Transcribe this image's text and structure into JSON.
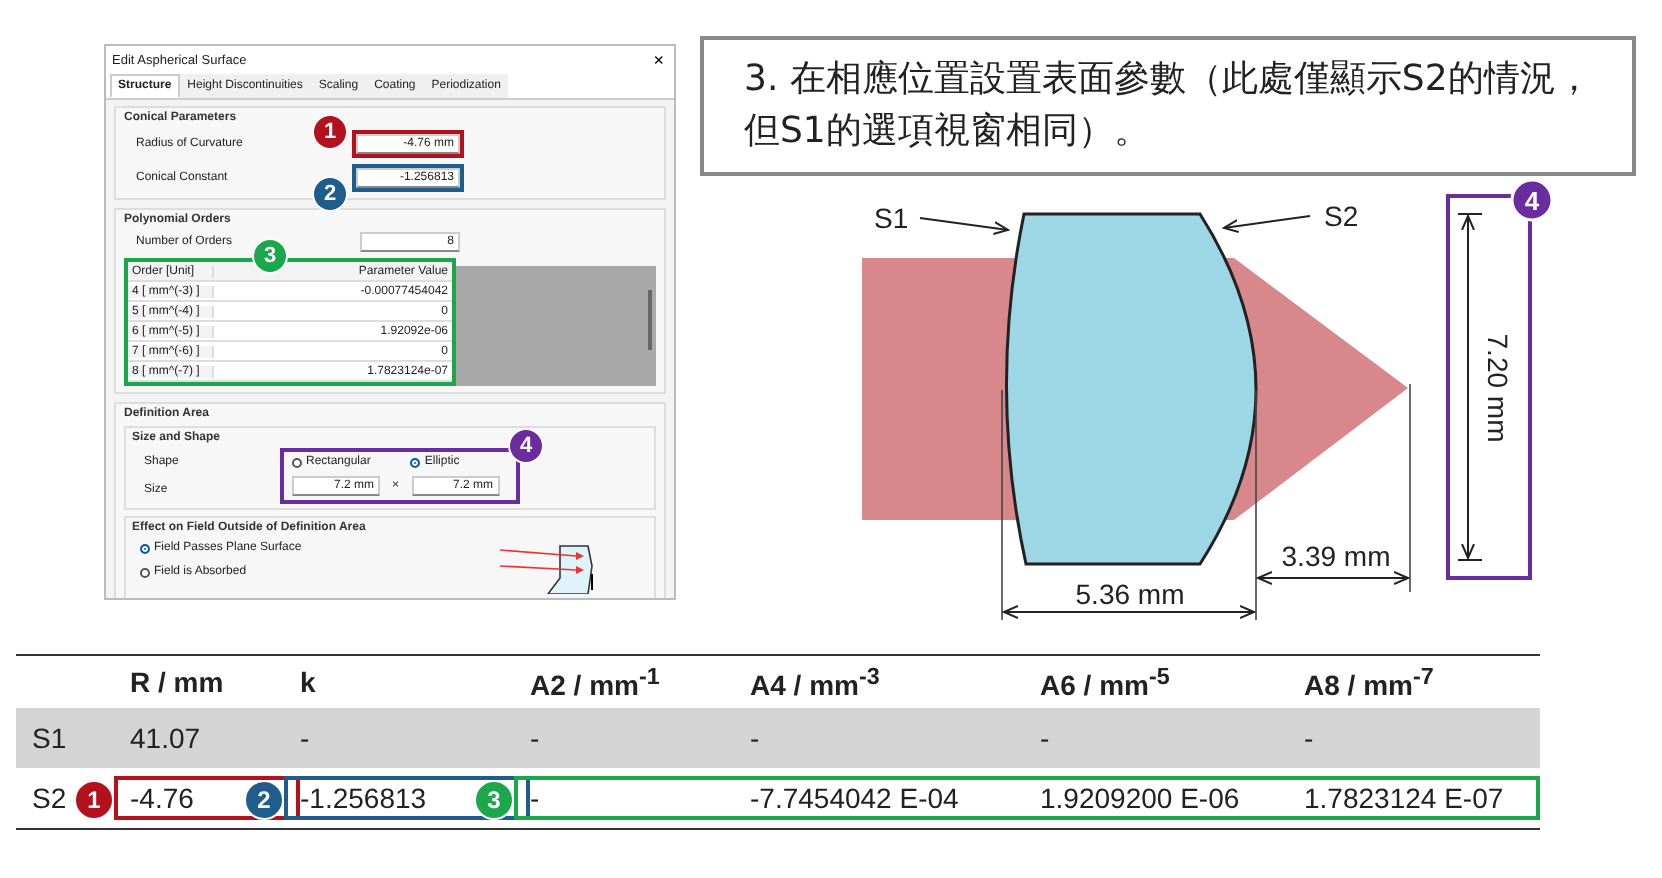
{
  "dialog": {
    "title": "Edit Aspherical Surface",
    "close": "×",
    "tabs": [
      {
        "label": "Structure",
        "selected": true
      },
      {
        "label": "Height Discontinuities",
        "selected": false
      },
      {
        "label": "Scaling",
        "selected": false
      },
      {
        "label": "Coating",
        "selected": false
      },
      {
        "label": "Periodization",
        "selected": false
      }
    ],
    "conical_parameters": {
      "title": "Conical Parameters",
      "fields": [
        {
          "label": "Radius of Curvature",
          "value": "-4.76 mm",
          "callout": "1",
          "color": "#b3121c"
        },
        {
          "label": "Conical Constant",
          "value": "-1.256813",
          "callout": "2",
          "color": "#1f5d8c"
        }
      ]
    },
    "polynomial_orders": {
      "title": "Polynomial Orders",
      "number_label": "Number of Orders",
      "number_value": "8",
      "callout": "3",
      "color": "#1aa84b",
      "columns": [
        "Order [Unit]",
        "Parameter Value"
      ],
      "rows": [
        {
          "order": "4  [ mm^(-3) ]",
          "value": "-0.00077454042"
        },
        {
          "order": "5  [ mm^(-4) ]",
          "value": "0"
        },
        {
          "order": "6  [ mm^(-5) ]",
          "value": "1.92092e-06"
        },
        {
          "order": "7  [ mm^(-6) ]",
          "value": "0"
        },
        {
          "order": "8  [ mm^(-7) ]",
          "value": "1.7823124e-07"
        }
      ]
    },
    "definition_area": {
      "title": "Definition Area",
      "size_and_shape": {
        "title": "Size and Shape",
        "callout": "4",
        "color": "#6a2c9e",
        "shape_label": "Shape",
        "options": [
          {
            "label": "Rectangular",
            "selected": false
          },
          {
            "label": "Elliptic",
            "selected": true
          }
        ],
        "size_label": "Size",
        "width": "7.2 mm",
        "separator": "×",
        "height": "7.2 mm"
      },
      "effect": {
        "title": "Effect on Field Outside of Definition Area",
        "options": [
          {
            "label": "Field Passes Plane Surface",
            "selected": true
          },
          {
            "label": "Field is Absorbed",
            "selected": false
          }
        ]
      }
    }
  },
  "note": "3. 在相應位置設置表面參數（此處僅顯示S2的情況，但S1的選項視窗相同）。",
  "diagram": {
    "surface_labels": [
      "S1",
      "S2"
    ],
    "thickness": "5.36 mm",
    "distance": "3.39 mm",
    "aperture": "7.20 mm",
    "callout": "4",
    "color": "#6a2c9e"
  },
  "table": {
    "columns": [
      "",
      "R / mm",
      "k",
      "A2 / mm$^{-1}$",
      "A4 / mm$^{-3}$",
      "A6 / mm$^{-5}$",
      "A8 / mm$^{-7}$"
    ],
    "rows": [
      {
        "label": "S1",
        "shaded": true,
        "groups": [
          {
            "cells": [
              "41.07"
            ]
          },
          {
            "cells": [
              "-"
            ]
          },
          {
            "cells": [
              "-",
              "-",
              "-",
              "-"
            ]
          }
        ]
      },
      {
        "label": "S2",
        "shaded": false,
        "groups": [
          {
            "callout": "1",
            "color": "#b3121c",
            "cells": [
              "-4.76"
            ]
          },
          {
            "callout": "2",
            "color": "#1f5d8c",
            "cells": [
              "-1.256813"
            ]
          },
          {
            "callout": "3",
            "color": "#1aa84b",
            "cells": [
              "-",
              "-7.7454042 E-04",
              "1.9209200 E-06",
              "1.7823124 E-07"
            ]
          }
        ]
      }
    ]
  }
}
